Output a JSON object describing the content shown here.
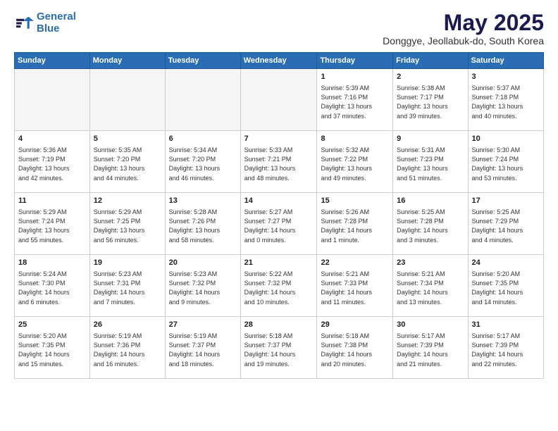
{
  "logo": {
    "line1": "General",
    "line2": "Blue"
  },
  "title": "May 2025",
  "subtitle": "Donggye, Jeollabuk-do, South Korea",
  "days_header": [
    "Sunday",
    "Monday",
    "Tuesday",
    "Wednesday",
    "Thursday",
    "Friday",
    "Saturday"
  ],
  "weeks": [
    [
      {
        "num": "",
        "info": ""
      },
      {
        "num": "",
        "info": ""
      },
      {
        "num": "",
        "info": ""
      },
      {
        "num": "",
        "info": ""
      },
      {
        "num": "1",
        "info": "Sunrise: 5:39 AM\nSunset: 7:16 PM\nDaylight: 13 hours\nand 37 minutes."
      },
      {
        "num": "2",
        "info": "Sunrise: 5:38 AM\nSunset: 7:17 PM\nDaylight: 13 hours\nand 39 minutes."
      },
      {
        "num": "3",
        "info": "Sunrise: 5:37 AM\nSunset: 7:18 PM\nDaylight: 13 hours\nand 40 minutes."
      }
    ],
    [
      {
        "num": "4",
        "info": "Sunrise: 5:36 AM\nSunset: 7:19 PM\nDaylight: 13 hours\nand 42 minutes."
      },
      {
        "num": "5",
        "info": "Sunrise: 5:35 AM\nSunset: 7:20 PM\nDaylight: 13 hours\nand 44 minutes."
      },
      {
        "num": "6",
        "info": "Sunrise: 5:34 AM\nSunset: 7:20 PM\nDaylight: 13 hours\nand 46 minutes."
      },
      {
        "num": "7",
        "info": "Sunrise: 5:33 AM\nSunset: 7:21 PM\nDaylight: 13 hours\nand 48 minutes."
      },
      {
        "num": "8",
        "info": "Sunrise: 5:32 AM\nSunset: 7:22 PM\nDaylight: 13 hours\nand 49 minutes."
      },
      {
        "num": "9",
        "info": "Sunrise: 5:31 AM\nSunset: 7:23 PM\nDaylight: 13 hours\nand 51 minutes."
      },
      {
        "num": "10",
        "info": "Sunrise: 5:30 AM\nSunset: 7:24 PM\nDaylight: 13 hours\nand 53 minutes."
      }
    ],
    [
      {
        "num": "11",
        "info": "Sunrise: 5:29 AM\nSunset: 7:24 PM\nDaylight: 13 hours\nand 55 minutes."
      },
      {
        "num": "12",
        "info": "Sunrise: 5:29 AM\nSunset: 7:25 PM\nDaylight: 13 hours\nand 56 minutes."
      },
      {
        "num": "13",
        "info": "Sunrise: 5:28 AM\nSunset: 7:26 PM\nDaylight: 13 hours\nand 58 minutes."
      },
      {
        "num": "14",
        "info": "Sunrise: 5:27 AM\nSunset: 7:27 PM\nDaylight: 14 hours\nand 0 minutes."
      },
      {
        "num": "15",
        "info": "Sunrise: 5:26 AM\nSunset: 7:28 PM\nDaylight: 14 hours\nand 1 minute."
      },
      {
        "num": "16",
        "info": "Sunrise: 5:25 AM\nSunset: 7:28 PM\nDaylight: 14 hours\nand 3 minutes."
      },
      {
        "num": "17",
        "info": "Sunrise: 5:25 AM\nSunset: 7:29 PM\nDaylight: 14 hours\nand 4 minutes."
      }
    ],
    [
      {
        "num": "18",
        "info": "Sunrise: 5:24 AM\nSunset: 7:30 PM\nDaylight: 14 hours\nand 6 minutes."
      },
      {
        "num": "19",
        "info": "Sunrise: 5:23 AM\nSunset: 7:31 PM\nDaylight: 14 hours\nand 7 minutes."
      },
      {
        "num": "20",
        "info": "Sunrise: 5:23 AM\nSunset: 7:32 PM\nDaylight: 14 hours\nand 9 minutes."
      },
      {
        "num": "21",
        "info": "Sunrise: 5:22 AM\nSunset: 7:32 PM\nDaylight: 14 hours\nand 10 minutes."
      },
      {
        "num": "22",
        "info": "Sunrise: 5:21 AM\nSunset: 7:33 PM\nDaylight: 14 hours\nand 11 minutes."
      },
      {
        "num": "23",
        "info": "Sunrise: 5:21 AM\nSunset: 7:34 PM\nDaylight: 14 hours\nand 13 minutes."
      },
      {
        "num": "24",
        "info": "Sunrise: 5:20 AM\nSunset: 7:35 PM\nDaylight: 14 hours\nand 14 minutes."
      }
    ],
    [
      {
        "num": "25",
        "info": "Sunrise: 5:20 AM\nSunset: 7:35 PM\nDaylight: 14 hours\nand 15 minutes."
      },
      {
        "num": "26",
        "info": "Sunrise: 5:19 AM\nSunset: 7:36 PM\nDaylight: 14 hours\nand 16 minutes."
      },
      {
        "num": "27",
        "info": "Sunrise: 5:19 AM\nSunset: 7:37 PM\nDaylight: 14 hours\nand 18 minutes."
      },
      {
        "num": "28",
        "info": "Sunrise: 5:18 AM\nSunset: 7:37 PM\nDaylight: 14 hours\nand 19 minutes."
      },
      {
        "num": "29",
        "info": "Sunrise: 5:18 AM\nSunset: 7:38 PM\nDaylight: 14 hours\nand 20 minutes."
      },
      {
        "num": "30",
        "info": "Sunrise: 5:17 AM\nSunset: 7:39 PM\nDaylight: 14 hours\nand 21 minutes."
      },
      {
        "num": "31",
        "info": "Sunrise: 5:17 AM\nSunset: 7:39 PM\nDaylight: 14 hours\nand 22 minutes."
      }
    ]
  ]
}
